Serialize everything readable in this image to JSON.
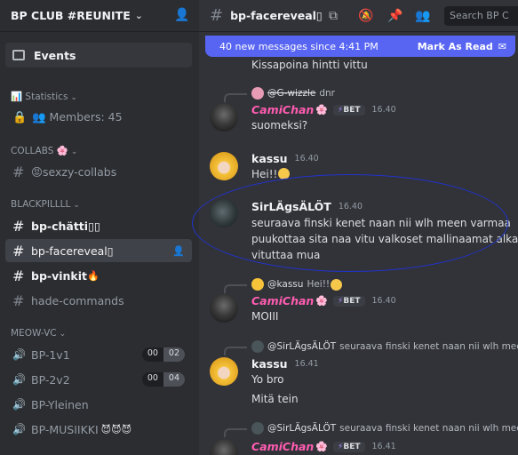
{
  "server": {
    "name": "BP CLUB #REUNITE",
    "chevron": "chevron-down-icon"
  },
  "sidebar": {
    "events_label": "Events",
    "statistics": {
      "label": "Statistics",
      "members_label": "Members: 45"
    },
    "categories": {
      "collabs": "COLLABS",
      "blackpill": "BLACKPILLLL",
      "meow_vc": "MEOW-VC"
    },
    "channels": {
      "sexzy": "😡sexzy-collabs",
      "chatti": "bp-chätti▯▯",
      "facereveal": "bp-facereveal▯",
      "vinkit": "bp-vinkit",
      "hade": "hade-commands"
    },
    "voice": [
      {
        "name": "BP-1v1",
        "a": "00",
        "b": "02"
      },
      {
        "name": "BP-2v2",
        "a": "00",
        "b": "04"
      },
      {
        "name": "BP-Yleinen"
      },
      {
        "name": "BP-MUSIIKKI"
      }
    ]
  },
  "header": {
    "channel": "bp-facereveal▯",
    "search_placeholder": "Search BP C"
  },
  "new_messages": {
    "text": "40 new messages since 4:41 PM",
    "action": "Mark As Read"
  },
  "messages": {
    "prev_line": "Kissapoina hintti vittu",
    "m1": {
      "reply_user": "@G-wizzle",
      "reply_text": "dnr",
      "user": "CamiChan",
      "tag": "BET",
      "time": "16.40",
      "text": "suomeksi?"
    },
    "m2": {
      "user": "kassu",
      "time": "16.40",
      "text": "Hei!!"
    },
    "m3": {
      "user": "SirLÄgsÄLÖT",
      "time": "16.40",
      "lines": [
        "seuraava finski kenet naan nii wlh meen varmaa",
        "puukottaa sita naa vitu valkoset mallinaamat alkaa",
        "vituttaa mua"
      ]
    },
    "m4": {
      "reply_user": "@kassu",
      "reply_text": "Hei!!",
      "user": "CamiChan",
      "tag": "BET",
      "time": "16.40",
      "text": "MOIII"
    },
    "m5": {
      "reply_user": "@SirLÄgsÄLÖT",
      "reply_text": "seuraava finski kenet naan nii wlh mee...",
      "user": "kassu",
      "time": "16.41",
      "line1": "Yo bro",
      "line2": "Mitä tein"
    },
    "m6": {
      "reply_user": "@SirLÄgsÄLÖT",
      "reply_text": "seuraava finski kenet naan nii wlh meen v",
      "user": "CamiChan",
      "tag": "BET",
      "time": "16.41"
    }
  },
  "colors": {
    "accent": "#5865f2",
    "pink_name": "#ff5cb1",
    "annotation": "#2233cc"
  }
}
